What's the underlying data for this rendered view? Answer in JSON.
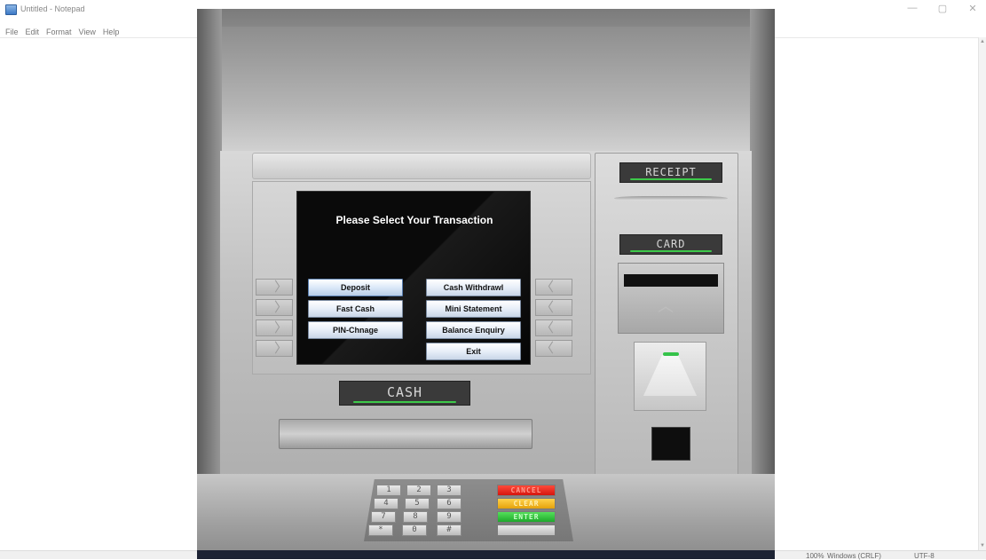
{
  "notepad": {
    "title": "Untitled - Notepad",
    "menu": [
      "File",
      "Edit",
      "Format",
      "View",
      "Help"
    ],
    "window_controls": [
      "—",
      "▢",
      "✕"
    ],
    "status": {
      "zoom": "100%",
      "line_ending": "Windows (CRLF)",
      "encoding": "UTF-8"
    }
  },
  "atm": {
    "screen_title": "Please Select Your Transaction",
    "transactions_left": [
      "Deposit",
      "Fast Cash",
      "PIN-Chnage"
    ],
    "transactions_right": [
      "Cash Withdrawl",
      "Mini Statement",
      "Balance Enquiry",
      "Exit"
    ],
    "selected_transaction": "Deposit",
    "labels": {
      "cash": "CASH",
      "receipt": "RECEIPT",
      "card": "CARD"
    },
    "keypad": {
      "keys": [
        "1",
        "2",
        "3",
        "4",
        "5",
        "6",
        "7",
        "8",
        "9",
        "*",
        "0",
        "#"
      ],
      "cancel": "CANCEL",
      "clear": "CLEAR",
      "enter": "ENTER"
    },
    "colors": {
      "indicator_green": "#3dc94a",
      "cancel_red": "#d5160e",
      "clear_yellow": "#e5a20c",
      "enter_green": "#1ea82c"
    }
  }
}
